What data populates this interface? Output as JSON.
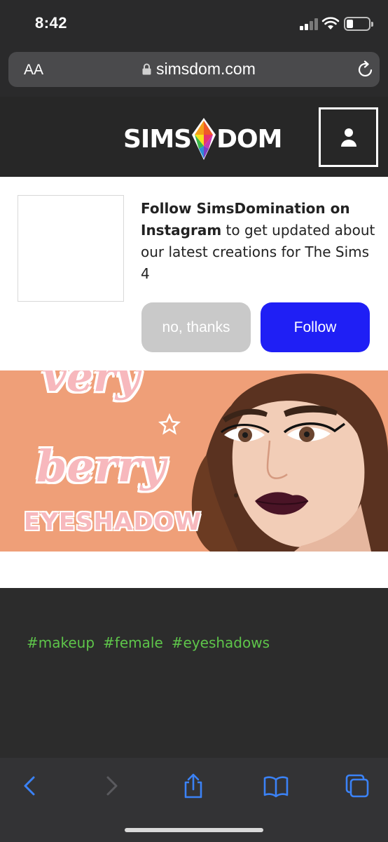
{
  "status_bar": {
    "time": "8:42"
  },
  "browser": {
    "text_size_label": "AA",
    "url": "simsdom.com"
  },
  "site_header": {
    "logo_left": "SIMS",
    "logo_right": "DOM"
  },
  "promo": {
    "text_bold": "Follow SimsDomination on Instagram",
    "text_rest": " to get updated about our latest creations for The Sims 4",
    "decline_label": "no, thanks",
    "follow_label": "Follow"
  },
  "banner": {
    "word1": "very",
    "word2": "berry",
    "word3": "EYESHADOW"
  },
  "tags": [
    "#makeup",
    "#female",
    "#eyeshadows"
  ],
  "colors": {
    "follow_button": "#1f1ff5",
    "decline_button": "#c9c9c9",
    "tag_green": "#5ec54a",
    "toolbar_blue": "#3b82f6",
    "banner_peach": "#ef9f78"
  }
}
